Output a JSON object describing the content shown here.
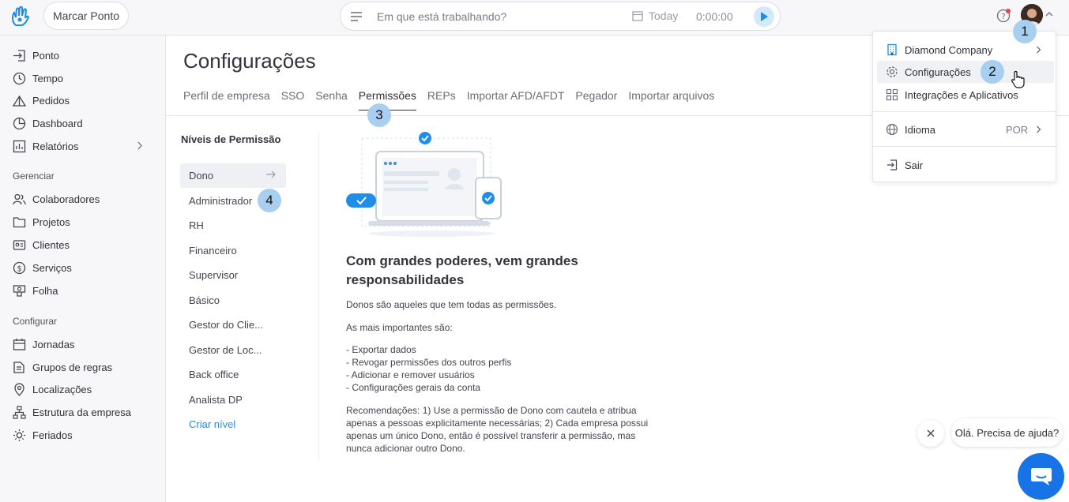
{
  "topbar": {
    "punch_label": "Marcar Ponto",
    "tracker_placeholder": "Em que está trabalhando?",
    "date_label": "Today",
    "timer": "0:00:00"
  },
  "sidebar": {
    "items_top": [
      {
        "label": "Ponto",
        "icon": "login-icon"
      },
      {
        "label": "Tempo",
        "icon": "clock-icon"
      },
      {
        "label": "Pedidos",
        "icon": "tent-icon"
      },
      {
        "label": "Dashboard",
        "icon": "pie-chart-icon"
      },
      {
        "label": "Relatórios",
        "icon": "bar-chart-icon"
      }
    ],
    "section_manage": "Gerenciar",
    "items_manage": [
      {
        "label": "Colaboradores",
        "icon": "users-icon"
      },
      {
        "label": "Projetos",
        "icon": "folder-icon"
      },
      {
        "label": "Clientes",
        "icon": "card-icon"
      },
      {
        "label": "Serviços",
        "icon": "dollar-icon"
      },
      {
        "label": "Folha",
        "icon": "money-icon"
      }
    ],
    "section_config": "Configurar",
    "items_config": [
      {
        "label": "Jornadas",
        "icon": "calendar-icon"
      },
      {
        "label": "Grupos de regras",
        "icon": "rules-icon"
      },
      {
        "label": "Localizações",
        "icon": "pin-icon"
      },
      {
        "label": "Estrutura da empresa",
        "icon": "org-icon"
      },
      {
        "label": "Feriados",
        "icon": "sun-icon"
      }
    ]
  },
  "main": {
    "title": "Configurações",
    "tabs": [
      "Perfil de empresa",
      "SSO",
      "Senha",
      "Permissões",
      "REPs",
      "Importar AFD/AFDT",
      "Pegador",
      "Importar arquivos"
    ],
    "active_tab": "Permissões"
  },
  "levels": {
    "title": "Níveis de Permissão",
    "items": [
      "Dono",
      "Administrador",
      "RH",
      "Financeiro",
      "Supervisor",
      "Básico",
      "Gestor do Clie...",
      "Gestor de Loc...",
      "Back office",
      "Analista DP"
    ],
    "create": "Criar nível"
  },
  "detail": {
    "heading": "Com grandes poderes, vem grandes responsabilidades",
    "intro": "Donos são aqueles que tem todas as permissões.",
    "important": "As mais importantes são:",
    "bullets": [
      "- Exportar dados",
      "- Revogar permissões dos outros perfis",
      "- Adicionar e remover usuários",
      "- Configurações gerais da conta"
    ],
    "recommendation": "Recomendações: 1) Use a permissão de Dono com cautela e atribua apenas a pessoas explicitamente necessárias; 2) Cada empresa possui apenas um único Dono, então é possível transferir a permissão, mas nunca adicionar outro Dono."
  },
  "user_menu": {
    "company": "Diamond Company",
    "settings": "Configurações",
    "integrations": "Integrações e Aplicativos",
    "language": "Idioma",
    "language_value": "POR",
    "logout": "Sair"
  },
  "badges": [
    "1",
    "2",
    "3",
    "4"
  ],
  "chat": {
    "greeting": "Olá. Precisa de ajuda?"
  },
  "colors": {
    "accent": "#1e8ee8",
    "badge": "#a9cff0",
    "chat": "#1773e6"
  }
}
